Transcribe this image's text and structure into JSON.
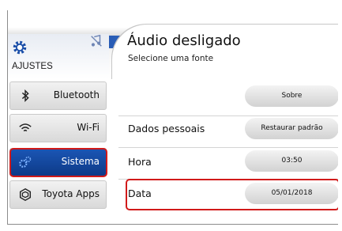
{
  "header": {
    "section_label": "AJUSTES",
    "title": "Áudio desligado",
    "subtitle": "Selecione uma fonte"
  },
  "sidebar": {
    "items": [
      {
        "label": "Bluetooth",
        "icon": "bluetooth-icon"
      },
      {
        "label": "Wi-Fi",
        "icon": "wifi-icon"
      },
      {
        "label": "Sistema",
        "icon": "system-gear-icon",
        "active": true
      },
      {
        "label": "Toyota Apps",
        "icon": "toyota-apps-icon"
      }
    ]
  },
  "settings": {
    "rows": [
      {
        "label": "",
        "button": "Sobre"
      },
      {
        "label": "Dados pessoais",
        "button": "Restaurar padrão"
      },
      {
        "label": "Hora",
        "button": "03:50"
      },
      {
        "label": "Data",
        "button": "05/01/2018"
      }
    ]
  },
  "colors": {
    "accent_blue": "#1a4ea8",
    "highlight_red": "#d11a1a"
  }
}
